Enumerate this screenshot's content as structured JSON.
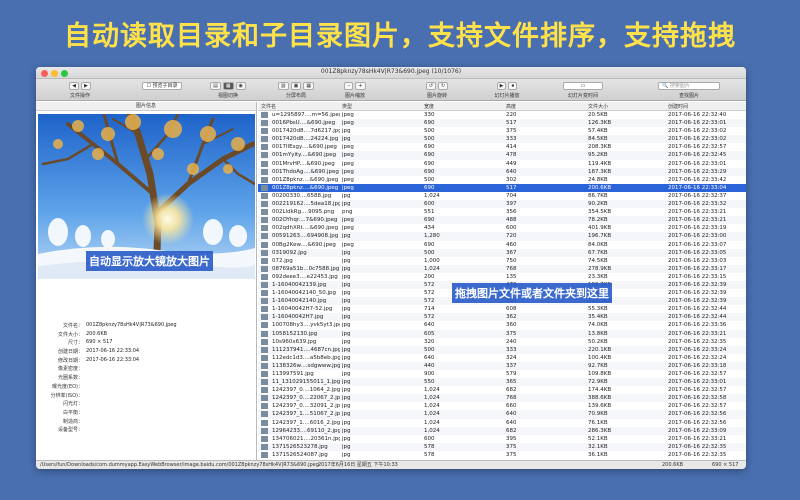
{
  "banner": "自动读取目录和子目录图片，支持文件排序，支持拖拽",
  "window": {
    "title": "001Z8pknzy78sHk4V|R73&690.jpeg  (10/1076)"
  },
  "toolbar": [
    {
      "label": "文件操作",
      "controls": [
        "◀",
        "▶"
      ]
    },
    {
      "label": "",
      "controls": [
        "☐ 预览子目录"
      ]
    },
    {
      "label": "视图切换",
      "controls": [
        "▤",
        "▦",
        "◉"
      ]
    },
    {
      "label": "分屏布局",
      "controls": [
        "▥",
        "▣",
        "▦"
      ]
    },
    {
      "label": "图片缩放",
      "controls": [
        "–",
        "+"
      ]
    },
    {
      "label": "图片旋转",
      "controls": [
        "↺",
        "↻"
      ]
    },
    {
      "label": "幻灯片播放",
      "controls": [
        "▶",
        "⏹"
      ]
    },
    {
      "label": "幻灯片变时间",
      "controls": [
        "▭"
      ]
    },
    {
      "label": "查找图片",
      "controls": [
        "🔍 搜索图片"
      ]
    }
  ],
  "left_pane": {
    "header": "图片信息",
    "overlay": "自动显示放大镜放大图片",
    "info": [
      {
        "key": "文件名：",
        "value": "001Z8pknzy78sHk4V|R73&690.jpeg"
      },
      {
        "key": "文件大小：",
        "value": "200.6KB"
      },
      {
        "key": "尺寸：",
        "value": "690 × 517"
      },
      {
        "key": "创建日期：",
        "value": "2017-06-16  22:33:04"
      },
      {
        "key": "修改日期：",
        "value": "2017-06-16  22:33:04"
      },
      {
        "key": "像素密度：",
        "value": ""
      },
      {
        "key": "光圈系数：",
        "value": ""
      },
      {
        "key": "曝光度(EO)：",
        "value": ""
      },
      {
        "key": "分辨率(ISO)：",
        "value": ""
      },
      {
        "key": "闪光灯：",
        "value": ""
      },
      {
        "key": "白平衡：",
        "value": ""
      },
      {
        "key": "制造商：",
        "value": ""
      },
      {
        "key": "设备型号：",
        "value": ""
      }
    ]
  },
  "list": {
    "columns": [
      "文件名",
      "类型",
      "宽度",
      "高度",
      "文件大小",
      "创建时间"
    ],
    "overlay": "拖拽图片文件或者文件夹到这里",
    "selected_index": 8,
    "rows": [
      [
        "u=1295897....m=56.jpeg",
        "jpeg",
        "330",
        "220",
        "20.5KB",
        "2017-06-16  22:32:40"
      ],
      [
        "0016PbsU....&690.jpeg",
        "jpeg",
        "690",
        "517",
        "126.3KB",
        "2017-06-16  22:33:01"
      ],
      [
        "0017420d8....7d6217.jpg",
        "jpg",
        "500",
        "375",
        "57.4KB",
        "2017-06-16  22:33:02"
      ],
      [
        "0017420d8....24224.jpg",
        "jpg",
        "500",
        "333",
        "84.5KB",
        "2017-06-16  22:33:02"
      ],
      [
        "0017IlEsgy....&690.jpeg",
        "jpeg",
        "690",
        "414",
        "208.3KB",
        "2017-06-16  22:32:57"
      ],
      [
        "001mYyity....&690.jpeg",
        "jpeg",
        "690",
        "478",
        "95.2KB",
        "2017-06-16  22:32:45"
      ],
      [
        "001MrvHP....&690.jpeg",
        "jpeg",
        "690",
        "449",
        "119.4KB",
        "2017-06-16  22:33:01"
      ],
      [
        "001ThdoAg....&690.jpeg",
        "jpeg",
        "690",
        "640",
        "187.3KB",
        "2017-06-16  22:33:29"
      ],
      [
        "001Z8pknz....&690.jpeg",
        "jpeg",
        "500",
        "302",
        "24.8KB",
        "2017-06-16  22:33:42"
      ],
      [
        "001Z8pknz....&690.jpeg",
        "jpeg",
        "690",
        "517",
        "200.6KB",
        "2017-06-16  22:33:04"
      ],
      [
        "00200330....6588.jpg",
        "jpg",
        "1,024",
        "704",
        "86.7KB",
        "2017-06-16  22:32:37"
      ],
      [
        "002219162....5dea18.jpg",
        "jpg",
        "600",
        "397",
        "90.2KB",
        "2017-06-16  22:33:32"
      ],
      [
        "002LldkRg....9095.png",
        "png",
        "551",
        "356",
        "354.5KB",
        "2017-06-16  22:33:21"
      ],
      [
        "002OYhqr....7&690.jpeg",
        "jpeg",
        "690",
        "488",
        "78.2KB",
        "2017-06-16  22:33:21"
      ],
      [
        "002qdhXRt....&690.jpeg",
        "jpeg",
        "434",
        "600",
        "401.9KB",
        "2017-06-16  22:33:19"
      ],
      [
        "00591263....694908.jpg",
        "jpg",
        "1,280",
        "720",
        "196.7KB",
        "2017-06-16  22:33:00"
      ],
      [
        "00Bg2Kew....&690.jpeg",
        "jpeg",
        "690",
        "460",
        "84.0KB",
        "2017-06-16  22:33:07"
      ],
      [
        "0319092.jpg",
        "jpg",
        "500",
        "367",
        "67.7KB",
        "2017-06-16  22:33:05"
      ],
      [
        "072.jpg",
        "jpg",
        "1,000",
        "750",
        "74.5KB",
        "2017-06-16  22:33:03"
      ],
      [
        "08769a51b...0c7588.jpg",
        "jpg",
        "1,024",
        "768",
        "278.9KB",
        "2017-06-16  22:33:17"
      ],
      [
        "092deee3....e22453.jpg",
        "jpg",
        "200",
        "135",
        "23.3KB",
        "2017-06-16  22:33:15"
      ],
      [
        "1-16040042139.jpg",
        "jpg",
        "572",
        "470",
        "109.7KB",
        "2017-06-16  22:32:39"
      ],
      [
        "1-16040042140_50.jpg",
        "jpg",
        "572",
        "426",
        "86.6KB",
        "2017-06-16  22:32:39"
      ],
      [
        "1-16040042140.jpg",
        "jpg",
        "572",
        "760",
        "111.1KB",
        "2017-06-16  22:32:39"
      ],
      [
        "1-16040042H7-52.jpg",
        "jpg",
        "714",
        "608",
        "55.3KB",
        "2017-06-16  22:32:44"
      ],
      [
        "1-16040042H7.jpg",
        "jpg",
        "572",
        "362",
        "35.4KB",
        "2017-06-16  22:32:44"
      ],
      [
        "100708hy3....yvk5yt3.jpg",
        "jpg",
        "640",
        "360",
        "74.0KB",
        "2017-06-16  22:33:36"
      ],
      [
        "1058152130.jpg",
        "jpg",
        "605",
        "375",
        "13.8KB",
        "2017-06-16  22:33:21"
      ],
      [
        "10s960x639.jpg",
        "jpg",
        "320",
        "240",
        "50.2KB",
        "2017-06-16  22:32:35"
      ],
      [
        "111237941....4687cn.jpg",
        "jpg",
        "500",
        "333",
        "220.1KB",
        "2017-06-16  22:33:24"
      ],
      [
        "112edc1d3....a5b8eb.jpg",
        "jpg",
        "640",
        "324",
        "100.4KB",
        "2017-06-16  22:32:24"
      ],
      [
        "1138326w....sdgwww.jpg",
        "jpg",
        "440",
        "337",
        "92.7KB",
        "2017-06-16  22:33:18"
      ],
      [
        "113997591.jpg",
        "jpg",
        "900",
        "579",
        "109.8KB",
        "2017-06-16  22:32:57"
      ],
      [
        "11_131029155011_1.jpg",
        "jpg",
        "550",
        "365",
        "72.9KB",
        "2017-06-16  22:33:01"
      ],
      [
        "1242397_0....1064_2.jpg",
        "jpg",
        "1,024",
        "682",
        "174.4KB",
        "2017-06-16  22:32:57"
      ],
      [
        "1242397_0....22067_2.jpg",
        "jpg",
        "1,024",
        "768",
        "388.6KB",
        "2017-06-16  22:32:58"
      ],
      [
        "1242397_0....32091_2.jpg",
        "jpg",
        "1,024",
        "660",
        "139.6KB",
        "2017-06-16  22:32:57"
      ],
      [
        "1242397_1....51067_2.jpg",
        "jpg",
        "1,024",
        "640",
        "70.9KB",
        "2017-06-16  22:32:56"
      ],
      [
        "1242397_1....6016_2.jpg",
        "jpg",
        "1,024",
        "640",
        "76.1KB",
        "2017-06-16  22:32:56"
      ],
      [
        "12964233....69110_2.jpg",
        "jpg",
        "1,024",
        "682",
        "286.3KB",
        "2017-06-16  22:33:09"
      ],
      [
        "134706021....20361n.jpg",
        "jpg",
        "600",
        "395",
        "52.1KB",
        "2017-06-16  22:33:21"
      ],
      [
        "1371526523278.jpg",
        "jpg",
        "578",
        "375",
        "32.1KB",
        "2017-06-16  22:32:35"
      ],
      [
        "1371526524087.jpg",
        "jpg",
        "578",
        "375",
        "36.1KB",
        "2017-06-16  22:32:35"
      ]
    ]
  },
  "statusbar": {
    "path": "/Users/fun/Downloads/com.dummyapp.EasyWebBrowser/image.baidu.com/001Z8pknzy78sHk4V|R73&690.jpeg",
    "date": "2017年6月16日 星期五 下午10:33",
    "size": "200.6KB",
    "dims": "690 × 517"
  },
  "colors": {
    "background": "#4a6fb0",
    "banner": "#ffe14a",
    "selection": "#2b63d9",
    "overlay": "#285ac8"
  }
}
